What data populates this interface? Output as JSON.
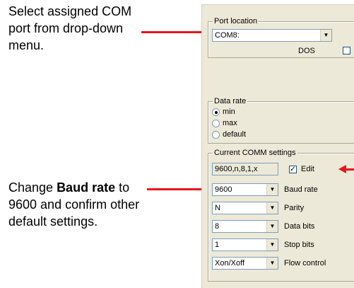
{
  "annotations": {
    "note1": "Select assigned COM port from drop-down menu.",
    "note2_a": "Change ",
    "note2_b": "Baud rate",
    "note2_c": " to 9600 and confirm other default settings."
  },
  "port_location": {
    "title": "Port location",
    "selected": "COM8:",
    "dos_label": "DOS"
  },
  "data_rate": {
    "title": "Data rate",
    "options": [
      "min",
      "max",
      "default"
    ],
    "selected": "min"
  },
  "comm_settings": {
    "title": "Current COMM settings",
    "summary": "9600,n,8,1,x",
    "edit_label": "Edit",
    "edit_checked": true,
    "rows": [
      {
        "value": "9600",
        "label": "Baud rate"
      },
      {
        "value": "N",
        "label": "Parity"
      },
      {
        "value": "8",
        "label": "Data bits"
      },
      {
        "value": "1",
        "label": "Stop bits"
      },
      {
        "value": "Xon/Xoff",
        "label": "Flow control"
      }
    ]
  },
  "colors": {
    "arrow": "#e8141c",
    "panel": "#ece9d8"
  }
}
